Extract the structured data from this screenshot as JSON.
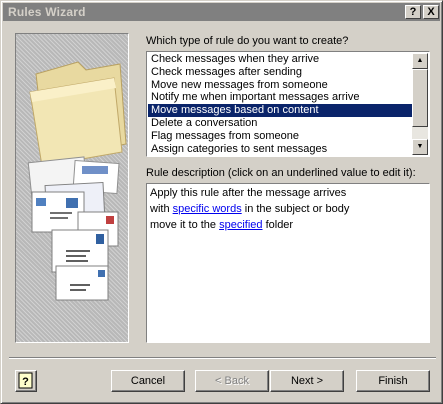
{
  "window": {
    "title": "Rules Wizard",
    "help_button": "?",
    "close_button": "X"
  },
  "rule_type": {
    "prompt": "Which type of rule do you want to create?",
    "items": [
      {
        "label": "Check messages when they arrive",
        "selected": false
      },
      {
        "label": "Check messages after sending",
        "selected": false
      },
      {
        "label": "Move new messages from someone",
        "selected": false
      },
      {
        "label": "Notify me when important messages arrive",
        "selected": false
      },
      {
        "label": "Move messages based on content",
        "selected": true
      },
      {
        "label": "Delete a conversation",
        "selected": false
      },
      {
        "label": "Flag messages from someone",
        "selected": false
      },
      {
        "label": "Assign categories to sent messages",
        "selected": false
      }
    ]
  },
  "rule_description": {
    "prompt": "Rule description (click on an underlined value to edit it):",
    "line1": "Apply this rule after the message arrives",
    "line2_prefix": "with ",
    "line2_link": "specific words",
    "line2_suffix": " in the subject or body",
    "line3_prefix": "move it to the ",
    "line3_link": "specified",
    "line3_suffix": " folder"
  },
  "buttons": {
    "cancel": "Cancel",
    "back": "< Back",
    "next": "Next >",
    "finish": "Finish"
  },
  "colors": {
    "selection": "#0a246a",
    "link": "#0000ee",
    "dialog_face": "#d4d0c8"
  }
}
